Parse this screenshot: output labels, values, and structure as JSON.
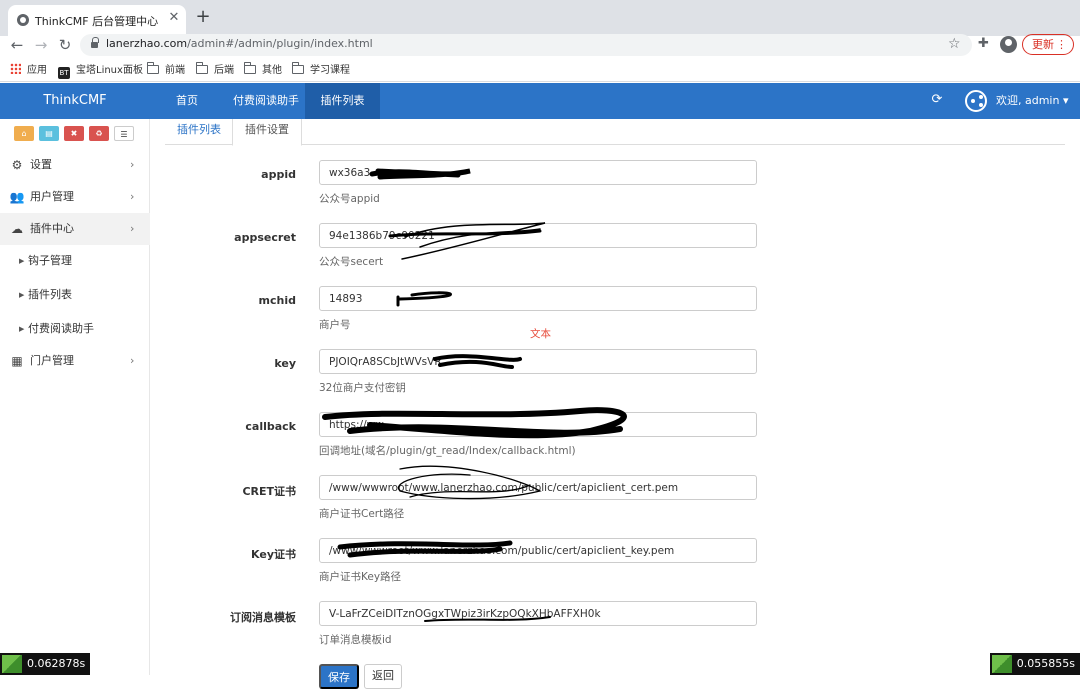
{
  "browser": {
    "tab_title": "ThinkCMF 后台管理中心",
    "url_host": "lanerzhao.com",
    "url_path": "/admin#/admin/plugin/index.html",
    "update_label": "更新",
    "bookmarks": [
      "应用",
      "宝塔Linux面板",
      "前端",
      "后端",
      "其他",
      "学习课程"
    ],
    "bt_badge": "BT"
  },
  "header": {
    "brand": "ThinkCMF",
    "nav": [
      "首页",
      "付费阅读助手",
      "插件列表"
    ],
    "welcome": "欢迎, admin"
  },
  "sidebar": {
    "items": [
      {
        "label": "设置",
        "icon": "gears-icon"
      },
      {
        "label": "用户管理",
        "icon": "users-icon"
      },
      {
        "label": "插件中心",
        "icon": "cloud-icon"
      },
      {
        "label": "门户管理",
        "icon": "grid-icon"
      }
    ],
    "subitems": [
      "钩子管理",
      "插件列表",
      "付费阅读助手"
    ]
  },
  "main": {
    "tabs": [
      "插件列表",
      "插件设置"
    ],
    "red_note": "文本",
    "fields": [
      {
        "label": "appid",
        "value": "wx36a3",
        "help": "公众号appid"
      },
      {
        "label": "appsecret",
        "value": "94e1386b79c90221",
        "help": "公众号secert"
      },
      {
        "label": "mchid",
        "value": "14893",
        "help": "商户号"
      },
      {
        "label": "key",
        "value": "PJOIQrA8SCbJtWVsVR",
        "help": "32位商户支付密钥"
      },
      {
        "label": "callback",
        "value": "https://ww",
        "help": "回调地址(域名/plugin/gt_read/Index/callback.html)"
      },
      {
        "label": "CRET证书",
        "value": "/www/wwwroot/www.lanerzhao.com/public/cert/apiclient_cert.pem",
        "help": "商户证书Cert路径"
      },
      {
        "label": "Key证书",
        "value": "/www/wwwroot/www.lanerzhao.com/public/cert/apiclient_key.pem",
        "help": "商户证书Key路径"
      },
      {
        "label": "订阅消息模板",
        "value": "V-LaFrZCeiDITznOGgxTWpiz3irKzpOQkXHbAFFXH0k",
        "help": "订单消息模板id"
      }
    ],
    "save_label": "保存",
    "back_label": "返回"
  },
  "timers": {
    "left": "0.062878s",
    "right": "0.055855s"
  },
  "colors": {
    "primary": "#2c74c7",
    "primary_dark": "#1f5ea8",
    "danger": "#d9534f"
  }
}
